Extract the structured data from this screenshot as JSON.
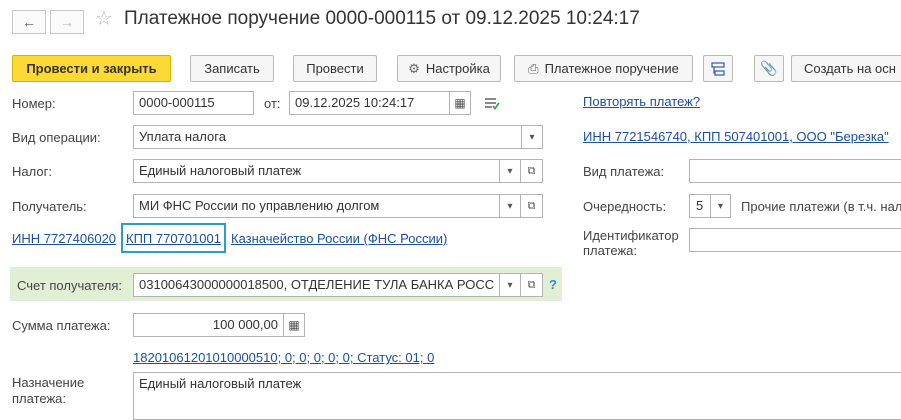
{
  "header": {
    "title": "Платежное поручение 0000-000115 от 09.12.2025 10:24:17",
    "back_icon": "arrow-left-icon",
    "forward_icon": "arrow-right-icon",
    "favorite_icon": "star-icon"
  },
  "toolbar": {
    "post_close": "Провести и закрыть",
    "save": "Записать",
    "post": "Провести",
    "settings": "Настройка",
    "print_order": "Платежное поручение",
    "create_based": "Создать на осн"
  },
  "form": {
    "number_label": "Номер:",
    "number_value": "0000-000115",
    "date_from_label": "от:",
    "date_value": "09.12.2025 10:24:17",
    "operation_label": "Вид операции:",
    "operation_value": "Уплата налога",
    "tax_label": "Налог:",
    "tax_value": "Единый налоговый платеж",
    "recipient_label": "Получатель:",
    "recipient_value": "МИ ФНС России по управлению долгом",
    "recipient_inn": "ИНН 7727406020",
    "recipient_kpp": "КПП 770701001",
    "recipient_treasury": "Казначейство России (ФНС России)",
    "account_label": "Счет получателя:",
    "account_value": "03100643000000018500, ОТДЕЛЕНИЕ ТУЛА БАНКА РОСС",
    "account_help": "?",
    "amount_label": "Сумма платежа:",
    "amount_value": "100 000,00",
    "kbk_link": "18201061201010000510; 0; 0; 0; 0; 0; Статус: 01; 0",
    "purpose_label_1": "Назначение",
    "purpose_label_2": "платежа:",
    "purpose_value": "Единый налоговый платеж"
  },
  "right": {
    "repeat_link": "Повторять платеж?",
    "payer_link": "ИНН 7721546740, КПП 507401001, ООО \"Березка\"",
    "payment_type_label": "Вид платежа:",
    "payment_type_value": "",
    "priority_label": "Очередность:",
    "priority_value": "5",
    "priority_desc": "Прочие платежи (в т.ч. нал",
    "identifier_label_1": "Идентификатор",
    "identifier_label_2": "платежа:",
    "identifier_value": ""
  },
  "colors": {
    "primary_button": "#fdd935",
    "link": "#1c50a3",
    "highlight": "#2aa1c0",
    "account_band": "#e1f0d4"
  }
}
